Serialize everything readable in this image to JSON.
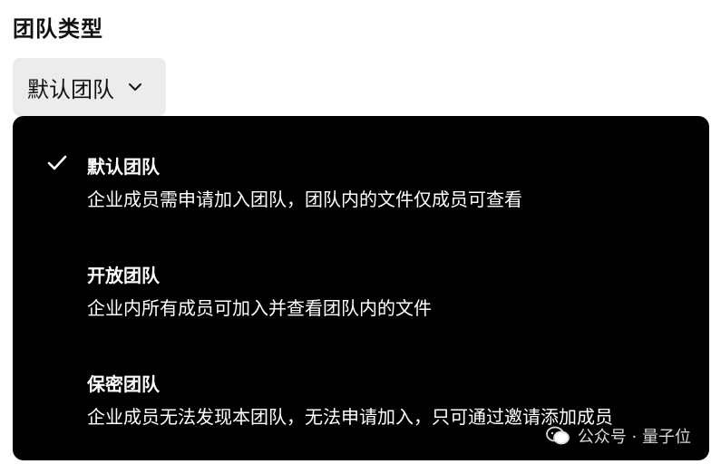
{
  "section": {
    "title": "团队类型"
  },
  "select": {
    "selected_label": "默认团队",
    "icon": "chevron-down-icon"
  },
  "dropdown": {
    "options": [
      {
        "title": "默认团队",
        "description": "企业成员需申请加入团队，团队内的文件仅成员可查看",
        "selected": true
      },
      {
        "title": "开放团队",
        "description": "企业内所有成员可加入并查看团队内的文件",
        "selected": false
      },
      {
        "title": "保密团队",
        "description": "企业成员无法发现本团队，无法申请加入，只可通过邀请添加成员",
        "selected": false
      }
    ]
  },
  "watermark": {
    "text": "公众号 · 量子位",
    "icon": "wechat-icon"
  },
  "colors": {
    "dropdown_bg": "#000000",
    "trigger_bg": "#ececec",
    "text_primary": "#111111",
    "option_text": "#ffffff"
  }
}
